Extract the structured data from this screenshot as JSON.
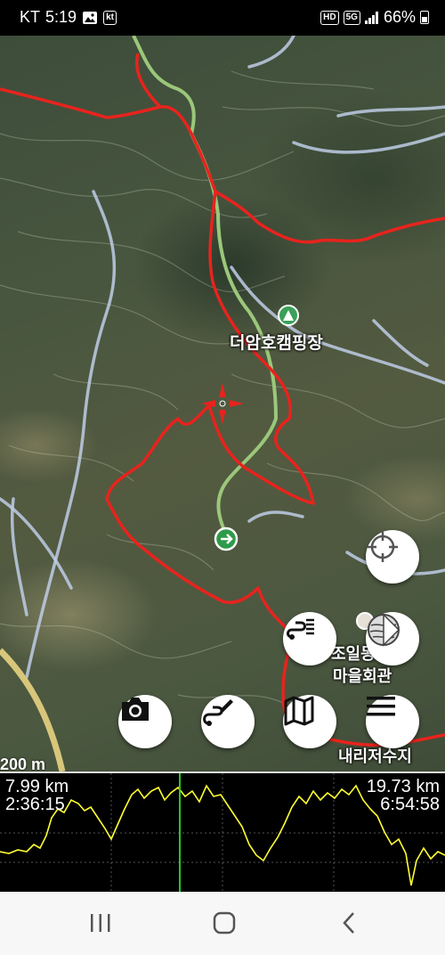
{
  "status_bar": {
    "carrier": "KT",
    "time": "5:19",
    "app_badge": "kt",
    "hd_badge": "HD",
    "net_badge": "5G",
    "battery_percent": "66%"
  },
  "map": {
    "poi_campsite": "더암호캠핑장",
    "poi_hall_line1": "조일동",
    "poi_hall_line2": "마을회관",
    "poi_reservoir": "내리저수지",
    "scale_label": "200 m"
  },
  "buttons": {
    "locate_icon": "crosshair-target-icon",
    "route_list_icon": "route-list-icon",
    "layers_icon": "map-layers-icon",
    "camera_icon": "camera-icon",
    "draw_route_icon": "route-pen-icon",
    "map_icon": "folded-map-icon",
    "menu_icon": "hamburger-menu-icon"
  },
  "elevation": {
    "left_distance": "7.99 km",
    "left_time": "2:36:15",
    "right_distance": "19.73 km",
    "right_time": "6:54:58",
    "line_color": "#ffff33",
    "cursor_color": "#22cc22"
  },
  "colors": {
    "track": "#e8231d",
    "trail": "#9bc77a"
  }
}
